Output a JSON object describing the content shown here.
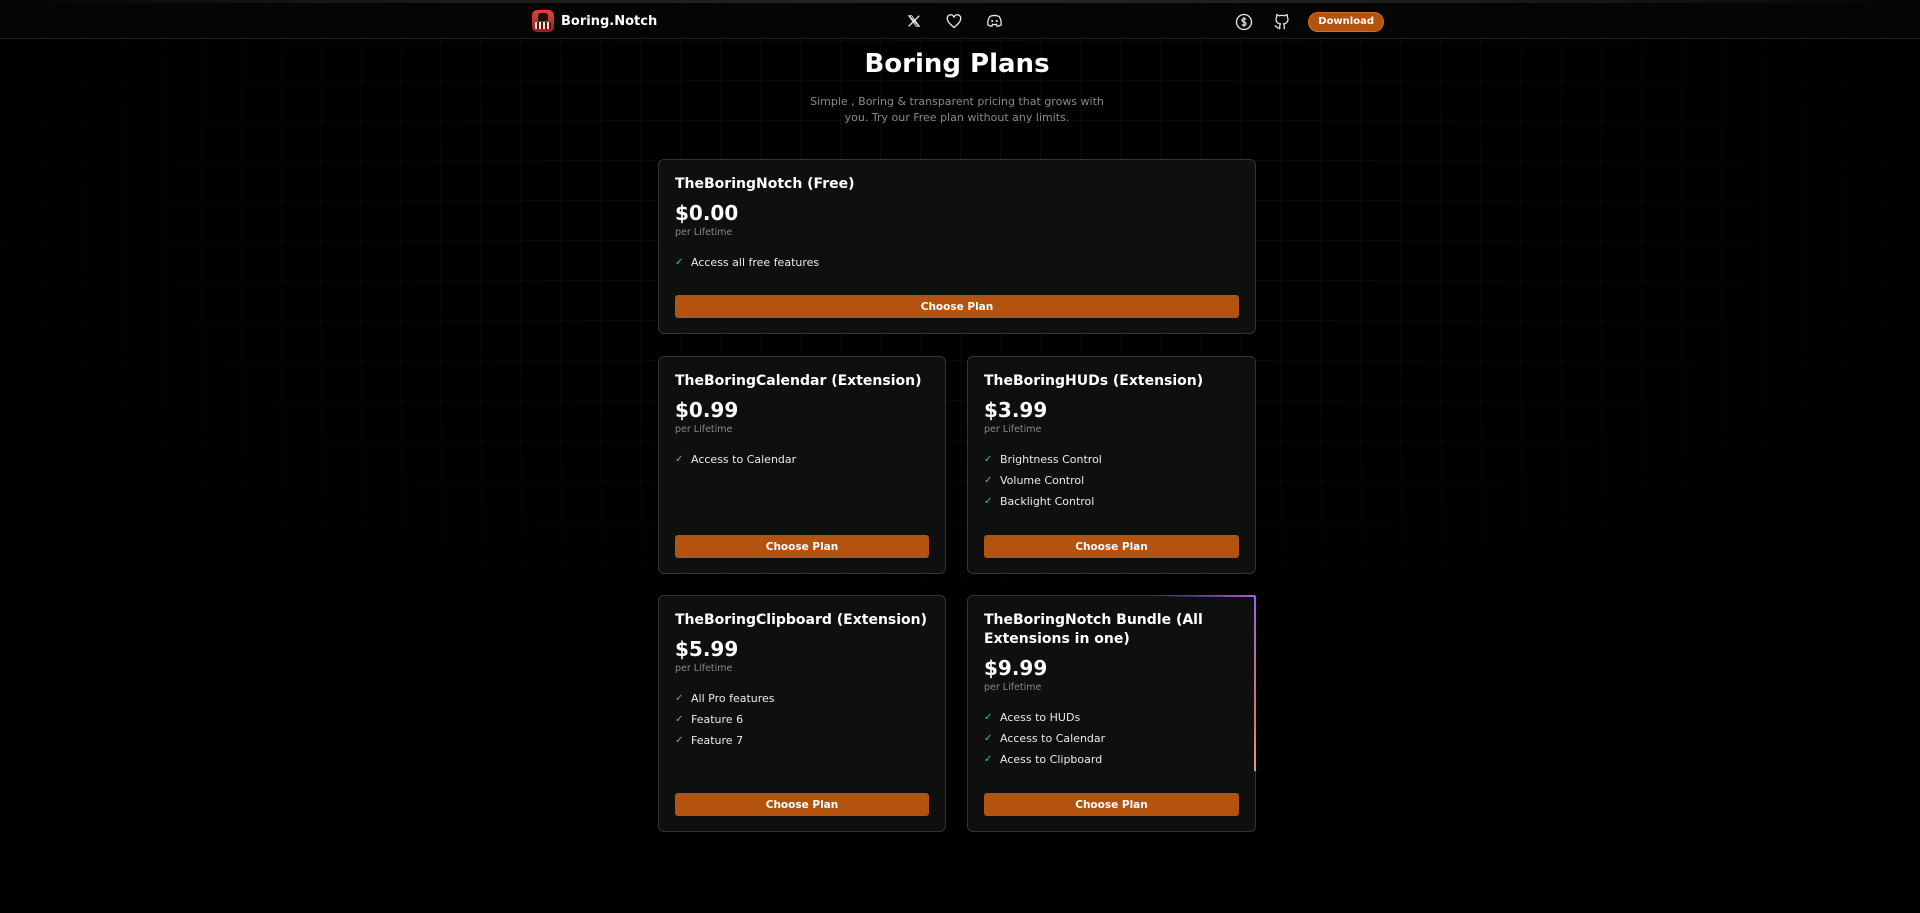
{
  "nav": {
    "brand": "Boring.Notch",
    "download_label": "Download"
  },
  "page": {
    "title": "Boring Plans",
    "subtitle": "Simple , Boring & transparent pricing that grows with you. Try our Free plan without any limits."
  },
  "plans": [
    {
      "name": "TheBoringNotch (Free)",
      "price": "$0.00",
      "period": "per Lifetime",
      "features": [
        "Access all free features"
      ],
      "button": "Choose Plan"
    },
    {
      "name": "TheBoringCalendar (Extension)",
      "price": "$0.99",
      "period": "per Lifetime",
      "features": [
        "Access to Calendar"
      ],
      "button": "Choose Plan"
    },
    {
      "name": "TheBoringHUDs (Extension)",
      "price": "$3.99",
      "period": "per Lifetime",
      "features": [
        "Brightness Control",
        "Volume Control",
        "Backlight Control"
      ],
      "button": "Choose Plan"
    },
    {
      "name": "TheBoringClipboard (Extension)",
      "price": "$5.99",
      "period": "per Lifetime",
      "features": [
        "All Pro features",
        "Feature 6",
        "Feature 7"
      ],
      "button": "Choose Plan"
    },
    {
      "name": "TheBoringNotch Bundle (All Extensions in one)",
      "price": "$9.99",
      "period": "per Lifetime",
      "features": [
        "Acess to HUDs",
        "Access to Calendar",
        "Acess to Clipboard"
      ],
      "button": "Choose Plan"
    }
  ],
  "colors": {
    "accent": "#b4520f",
    "check": "#34c38f",
    "highlight": "#9d5deb"
  }
}
